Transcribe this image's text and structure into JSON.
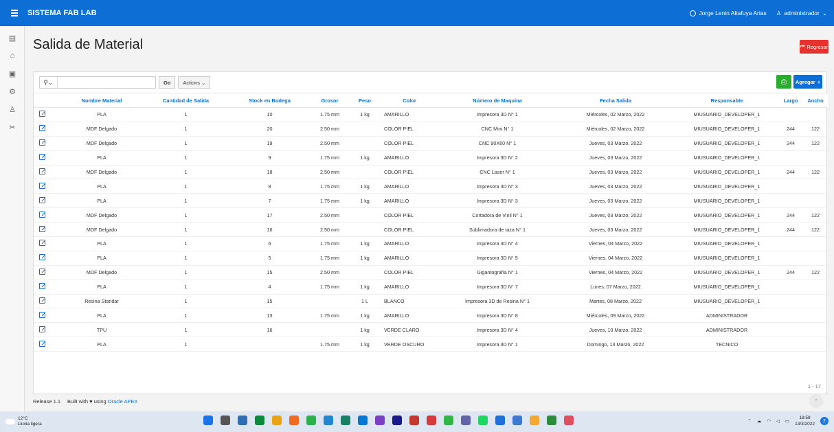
{
  "topbar": {
    "title": "SISTEMA FAB LAB",
    "user_name": "Jorge Lenin Altafuya Arias",
    "role": "administrador"
  },
  "sidebar": {
    "items": [
      {
        "icon": "file-icon",
        "glyph": "▤"
      },
      {
        "icon": "bank-icon",
        "glyph": "⌂"
      },
      {
        "icon": "screen-icon",
        "glyph": "▣"
      },
      {
        "icon": "gear-icon",
        "glyph": "⚙"
      },
      {
        "icon": "users-icon",
        "glyph": "♙"
      },
      {
        "icon": "tools-icon",
        "glyph": "✂"
      }
    ]
  },
  "page": {
    "title": "Salida de Material",
    "back_label": "Regresar"
  },
  "toolbar": {
    "search_placeholder": "",
    "go_label": "Go",
    "actions_label": "Actions",
    "add_label": "Agregar"
  },
  "table": {
    "columns": [
      "",
      "Nombre Material",
      "Cantidad de Salida",
      "Stock en Bodega",
      "Grosor",
      "Peso",
      "Color",
      "Número de Maquina",
      "Fecha Salida",
      "Responsable",
      "Largo",
      "Ancho"
    ],
    "rows": [
      [
        "PLA",
        "1",
        "10",
        "1.75 mm",
        "1 kg",
        "AMARILLO",
        "Impresora 3D N° 1",
        "Miércoles, 02 Marzo, 2022",
        "MIUSUARIO_DEVELOPER_1",
        "",
        ""
      ],
      [
        "MDF Delgado",
        "1",
        "20",
        "2.50 mm",
        "",
        "COLOR PIEL",
        "CNC Mini N° 1",
        "Miércoles, 02 Marzo, 2022",
        "MIUSUARIO_DEVELOPER_1",
        "244",
        "122"
      ],
      [
        "MDF Delgado",
        "1",
        "19",
        "2.50 mm",
        "",
        "COLOR PIEL",
        "CNC 90X60 N° 1",
        "Jueves, 03 Marzo, 2022",
        "MIUSUARIO_DEVELOPER_1",
        "244",
        "122"
      ],
      [
        "PLA",
        "1",
        "9",
        "1.75 mm",
        "1 kg",
        "AMARILLO",
        "Impresora 3D N° 2",
        "Jueves, 03 Marzo, 2022",
        "MIUSUARIO_DEVELOPER_1",
        "",
        ""
      ],
      [
        "MDF Delgado",
        "1",
        "18",
        "2.50 mm",
        "",
        "COLOR PIEL",
        "CNC Laser N° 1",
        "Jueves, 03 Marzo, 2022",
        "MIUSUARIO_DEVELOPER_1",
        "244",
        "122"
      ],
      [
        "PLA",
        "1",
        "8",
        "1.75 mm",
        "1 kg",
        "AMARILLO",
        "Impresora 3D N° 3",
        "Jueves, 03 Marzo, 2022",
        "MIUSUARIO_DEVELOPER_1",
        "",
        ""
      ],
      [
        "PLA",
        "1",
        "7",
        "1.75 mm",
        "1 kg",
        "AMARILLO",
        "Impresora 3D N° 3",
        "Jueves, 03 Marzo, 2022",
        "MIUSUARIO_DEVELOPER_1",
        "",
        ""
      ],
      [
        "MDF Delgado",
        "1",
        "17",
        "2.50 mm",
        "",
        "COLOR PIEL",
        "Cortadora de Vinil N° 1",
        "Jueves, 03 Marzo, 2022",
        "MIUSUARIO_DEVELOPER_1",
        "244",
        "122"
      ],
      [
        "MDF Delgado",
        "1",
        "16",
        "2.50 mm",
        "",
        "COLOR PIEL",
        "Sublimadora de taza N° 1",
        "Jueves, 03 Marzo, 2022",
        "MIUSUARIO_DEVELOPER_1",
        "244",
        "122"
      ],
      [
        "PLA",
        "1",
        "6",
        "1.75 mm",
        "1 kg",
        "AMARILLO",
        "Impresora 3D N° 4",
        "Viernes, 04 Marzo, 2022",
        "MIUSUARIO_DEVELOPER_1",
        "",
        ""
      ],
      [
        "PLA",
        "1",
        "5",
        "1.75 mm",
        "1 kg",
        "AMARILLO",
        "Impresora 3D N° 5",
        "Viernes, 04 Marzo, 2022",
        "MIUSUARIO_DEVELOPER_1",
        "",
        ""
      ],
      [
        "MDF Delgado",
        "1",
        "15",
        "2.50 mm",
        "",
        "COLOR PIEL",
        "Gigantografía N° 1",
        "Viernes, 04 Marzo, 2022",
        "MIUSUARIO_DEVELOPER_1",
        "244",
        "122"
      ],
      [
        "PLA",
        "1",
        "4",
        "1.75 mm",
        "1 kg",
        "AMARILLO",
        "Impresora 3D N° 7",
        "Lunes, 07 Marzo, 2022",
        "MIUSUARIO_DEVELOPER_1",
        "",
        ""
      ],
      [
        "Resina Standar",
        "1",
        "15",
        "",
        "1 L",
        "BLANCO",
        "Impresora 3D de Resina N° 1",
        "Martes, 08 Marzo, 2022",
        "MIUSUARIO_DEVELOPER_1",
        "",
        ""
      ],
      [
        "PLA",
        "1",
        "13",
        "1.75 mm",
        "1 kg",
        "AMARILLO",
        "Impresora 3D N° 8",
        "Miércoles, 09 Marzo, 2022",
        "ADMINISTRADOR",
        "",
        ""
      ],
      [
        "TPU",
        "1",
        "16",
        "",
        "1 kg",
        "VERDE CLARO",
        "Impresora 3D N° 4",
        "Jueves, 10 Marzo, 2022",
        "ADMINISTRADOR",
        "",
        ""
      ],
      [
        "PLA",
        "1",
        "",
        "1.75 mm",
        "1 kg",
        "VERDE OSCURO",
        "Impresora 3D N° 1",
        "Domingo, 13 Marzo, 2022",
        "TECNICO",
        "",
        ""
      ]
    ],
    "pagination": "1 - 17"
  },
  "footer": {
    "release": "Release 1.1",
    "built_with": "Built with",
    "heart": "♥",
    "using": "using",
    "link": "Oracle APEX"
  },
  "taskbar": {
    "temperature": "12°C",
    "weather": "Lluvia ligera",
    "time": "18:58",
    "date": "13/3/2022",
    "apps": [
      "#1a73e8",
      "#555555",
      "#2f6db5",
      "#0a8a3a",
      "#e8a317",
      "#f36b21",
      "#2bb24c",
      "#2185d0",
      "#1a7f64",
      "#0078d4",
      "#7b3fc4",
      "#1a1a8c",
      "#c5382e",
      "#d63a3a",
      "#2fb844",
      "#6264a7",
      "#1ed760",
      "#1e6fd9",
      "#3c7ad1",
      "#f2a833",
      "#2d8c3c",
      "#e04f5f"
    ]
  }
}
